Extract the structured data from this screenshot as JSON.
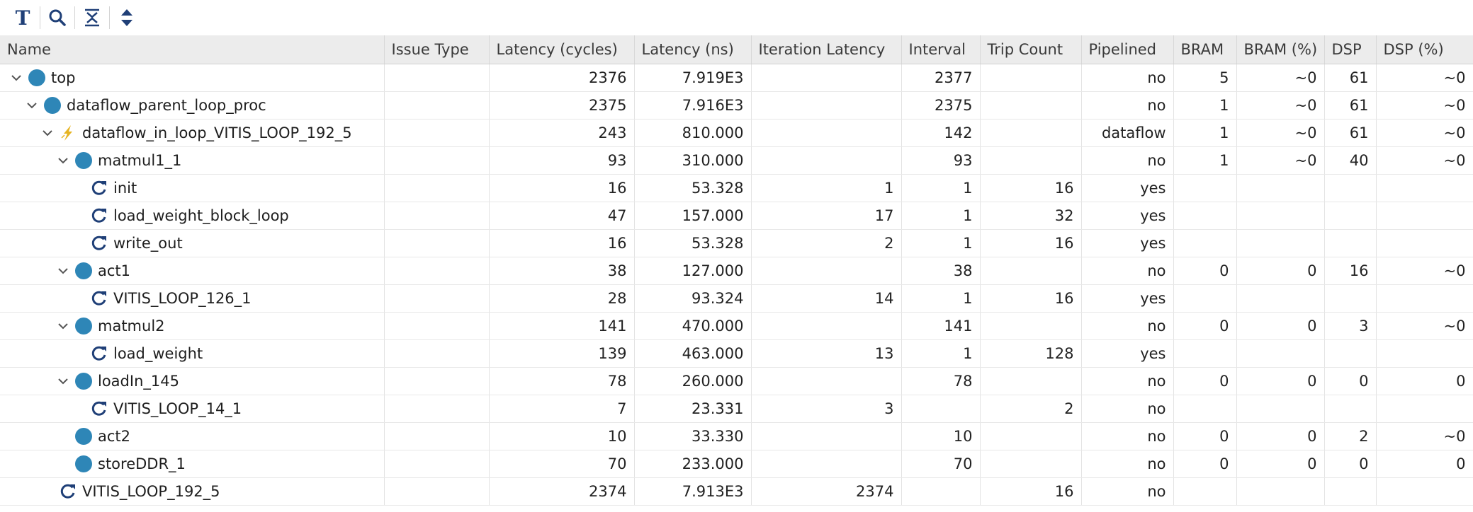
{
  "toolbar": {
    "buttons": [
      {
        "name": "text-format-button",
        "icon": "text-T-icon"
      },
      {
        "name": "search-button",
        "icon": "search-icon"
      },
      {
        "name": "collapse-all-button",
        "icon": "collapse-all-icon"
      },
      {
        "name": "expand-all-button",
        "icon": "expand-all-icon"
      }
    ],
    "text_glyph": "T"
  },
  "colors": {
    "icon_blue": "#2e86b7",
    "icon_dark": "#1f3f77",
    "dataflow_gold": "#e6b422",
    "header_bg": "#ececec"
  },
  "table": {
    "columns": [
      "Name",
      "Issue Type",
      "Latency (cycles)",
      "Latency (ns)",
      "Iteration Latency",
      "Interval",
      "Trip Count",
      "Pipelined",
      "BRAM",
      "BRAM (%)",
      "DSP",
      "DSP (%)"
    ],
    "rows": [
      {
        "name": "top",
        "level": 0,
        "icon": "module-dot-icon",
        "expanded": true,
        "cells": [
          "",
          "2376",
          "7.919E3",
          "",
          "2377",
          "",
          "no",
          "5",
          "~0",
          "61",
          "~0"
        ]
      },
      {
        "name": "dataflow_parent_loop_proc",
        "level": 1,
        "icon": "module-dot-icon",
        "expanded": true,
        "cells": [
          "",
          "2375",
          "7.916E3",
          "",
          "2375",
          "",
          "no",
          "1",
          "~0",
          "61",
          "~0"
        ]
      },
      {
        "name": "dataflow_in_loop_VITIS_LOOP_192_5",
        "level": 2,
        "icon": "dataflow-bolt-icon",
        "expanded": true,
        "cells": [
          "",
          "243",
          "810.000",
          "",
          "142",
          "",
          "dataflow",
          "1",
          "~0",
          "61",
          "~0"
        ]
      },
      {
        "name": "matmul1_1",
        "level": 3,
        "icon": "module-dot-icon",
        "expanded": true,
        "cells": [
          "",
          "93",
          "310.000",
          "",
          "93",
          "",
          "no",
          "1",
          "~0",
          "40",
          "~0"
        ]
      },
      {
        "name": "init",
        "level": 4,
        "icon": "loop-icon",
        "expanded": null,
        "cells": [
          "",
          "16",
          "53.328",
          "1",
          "1",
          "16",
          "yes",
          "",
          "",
          "",
          ""
        ]
      },
      {
        "name": "load_weight_block_loop",
        "level": 4,
        "icon": "loop-icon",
        "expanded": null,
        "cells": [
          "",
          "47",
          "157.000",
          "17",
          "1",
          "32",
          "yes",
          "",
          "",
          "",
          ""
        ]
      },
      {
        "name": "write_out",
        "level": 4,
        "icon": "loop-icon",
        "expanded": null,
        "cells": [
          "",
          "16",
          "53.328",
          "2",
          "1",
          "16",
          "yes",
          "",
          "",
          "",
          ""
        ]
      },
      {
        "name": "act1",
        "level": 3,
        "icon": "module-dot-icon",
        "expanded": true,
        "cells": [
          "",
          "38",
          "127.000",
          "",
          "38",
          "",
          "no",
          "0",
          "0",
          "16",
          "~0"
        ]
      },
      {
        "name": "VITIS_LOOP_126_1",
        "level": 4,
        "icon": "loop-icon",
        "expanded": null,
        "cells": [
          "",
          "28",
          "93.324",
          "14",
          "1",
          "16",
          "yes",
          "",
          "",
          "",
          ""
        ]
      },
      {
        "name": "matmul2",
        "level": 3,
        "icon": "module-dot-icon",
        "expanded": true,
        "cells": [
          "",
          "141",
          "470.000",
          "",
          "141",
          "",
          "no",
          "0",
          "0",
          "3",
          "~0"
        ]
      },
      {
        "name": "load_weight",
        "level": 4,
        "icon": "loop-icon",
        "expanded": null,
        "cells": [
          "",
          "139",
          "463.000",
          "13",
          "1",
          "128",
          "yes",
          "",
          "",
          "",
          ""
        ]
      },
      {
        "name": "loadIn_145",
        "level": 3,
        "icon": "module-dot-icon",
        "expanded": true,
        "cells": [
          "",
          "78",
          "260.000",
          "",
          "78",
          "",
          "no",
          "0",
          "0",
          "0",
          "0"
        ]
      },
      {
        "name": "VITIS_LOOP_14_1",
        "level": 4,
        "icon": "loop-icon",
        "expanded": null,
        "cells": [
          "",
          "7",
          "23.331",
          "3",
          "",
          "2",
          "no",
          "",
          "",
          "",
          ""
        ]
      },
      {
        "name": "act2",
        "level": 3,
        "icon": "module-dot-icon",
        "expanded": null,
        "cells": [
          "",
          "10",
          "33.330",
          "",
          "10",
          "",
          "no",
          "0",
          "0",
          "2",
          "~0"
        ]
      },
      {
        "name": "storeDDR_1",
        "level": 3,
        "icon": "module-dot-icon",
        "expanded": null,
        "cells": [
          "",
          "70",
          "233.000",
          "",
          "70",
          "",
          "no",
          "0",
          "0",
          "0",
          "0"
        ]
      },
      {
        "name": "VITIS_LOOP_192_5",
        "level": 2,
        "icon": "loop-icon",
        "expanded": null,
        "cells": [
          "",
          "2374",
          "7.913E3",
          "2374",
          "",
          "16",
          "no",
          "",
          "",
          "",
          ""
        ]
      }
    ]
  }
}
